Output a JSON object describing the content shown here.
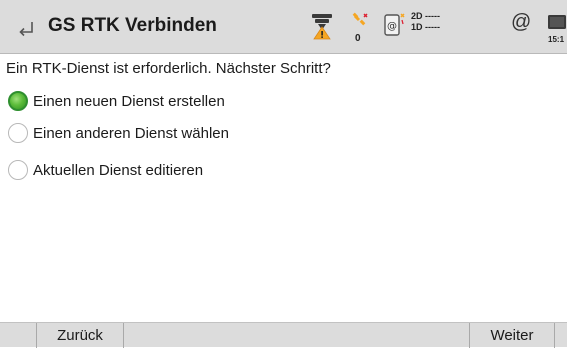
{
  "header": {
    "title": "GS RTK Verbinden",
    "back_icon": "back-arrow-icon",
    "status": {
      "gnss_icon": "gnss-antenna-warning-icon",
      "satellite_icon": "satellite-icon",
      "satellite_count": "0",
      "device_icon": "device-link-icon",
      "position_quality_2d": "2D -----",
      "position_quality_1d": "1D -----",
      "internet_icon": "at-sign-icon",
      "internet_symbol": "@",
      "battery_icon": "battery-icon",
      "time": "15:1"
    }
  },
  "prompt": "Ein RTK-Dienst ist erforderlich. Nächster Schritt?",
  "options": [
    {
      "label": "Einen neuen Dienst erstellen",
      "selected": true
    },
    {
      "label": "Einen anderen Dienst wählen",
      "selected": false
    },
    {
      "label": "Aktuellen Dienst editieren",
      "selected": false
    }
  ],
  "footer": {
    "back_label": "Zurück",
    "next_label": "Weiter"
  },
  "colors": {
    "bar_background": "#dcdcdc",
    "radio_selected": "#4caf2f",
    "warning": "#f5a623"
  }
}
